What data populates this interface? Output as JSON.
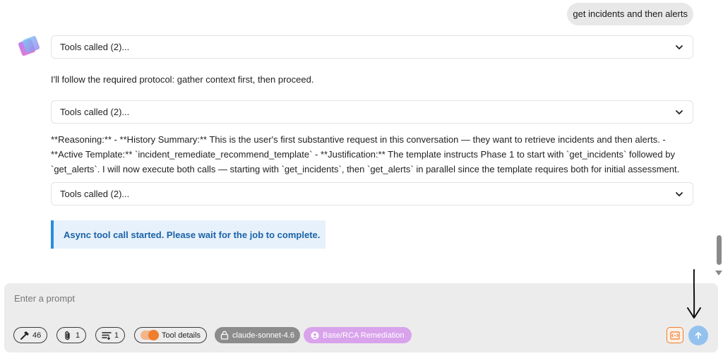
{
  "user_message": "get incidents and then alerts",
  "assistant": {
    "tool_groups": [
      {
        "label": "Tools called (2)..."
      },
      {
        "label": "Tools called (2)..."
      },
      {
        "label": "Tools called (2)..."
      }
    ],
    "text_1": "I'll follow the required protocol: gather context first, then proceed.",
    "text_2": "**Reasoning:** - **History Summary:** This is the user's first substantive request in this conversation — they want to retrieve incidents and then alerts. - **Active Template:** `incident_remediate_recommend_template` - **Justification:** The template instructs Phase 1 to start with `get_incidents` followed by `get_alerts`. I will now execute both calls — starting with `get_incidents`, then `get_alerts` in parallel since the template requires both for initial assessment.",
    "async_notice": "Async tool call started. Please wait for the job to complete."
  },
  "composer": {
    "placeholder": "Enter a prompt",
    "tools_count": "46",
    "attachments_count": "1",
    "list_count": "1",
    "tool_details_label": "Tool details",
    "model_label": "claude-sonnet-4.6",
    "template_label": "Base/RCA Remediation"
  },
  "colors": {
    "accent_orange": "#ef7e2d",
    "info_blue": "#2a8be0",
    "template_purple": "#d9a3ec",
    "send_blue": "#94c2ef"
  },
  "icons": [
    "hammer-icon",
    "paperclip-icon",
    "list-icon",
    "lock-icon",
    "user-circle-icon",
    "code-icon",
    "arrow-up-icon",
    "chevron-down-icon"
  ]
}
